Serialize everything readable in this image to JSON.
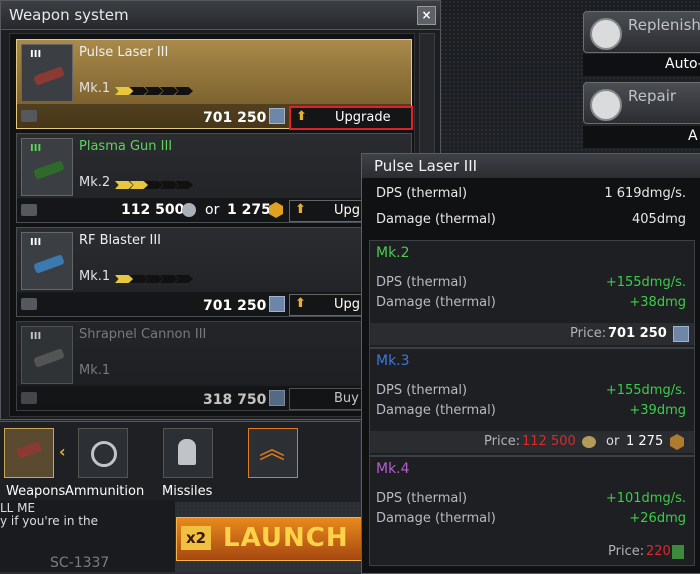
{
  "window": {
    "title": "Weapon system",
    "close_label": "×"
  },
  "weapons": [
    {
      "tier": "III",
      "name": "Pulse Laser III",
      "mk": "Mk.1",
      "level_fraction": 0.2,
      "price": "701 250",
      "button": "Upgrade",
      "selected": true
    },
    {
      "tier": "III",
      "name": "Plasma Gun III",
      "mk": "Mk.2",
      "level_fraction": 0.4,
      "price_red": "112 500",
      "or": "or",
      "price_alt": "1 275",
      "button": "Upgr",
      "selected": false
    },
    {
      "tier": "III",
      "name": "RF Blaster III",
      "mk": "Mk.1",
      "level_fraction": 0.2,
      "price": "701 250",
      "button": "Upgr",
      "selected": false
    },
    {
      "tier": "III",
      "name": "Shrapnel Cannon III",
      "mk": "Mk.1",
      "level_fraction": 0.0,
      "price": "318 750",
      "button": "Buy",
      "selected": false
    }
  ],
  "tabs": {
    "weapons": "Weapons",
    "ammunition": "Ammunition",
    "missiles": "Missiles"
  },
  "chat": {
    "line1": "LL ME",
    "line2": "y if you're in the"
  },
  "launch": {
    "multiplier": "x2",
    "label": "LAUNCH"
  },
  "callsign": "SC-1337",
  "side": {
    "replenish": "Replenish",
    "auto": "Auto-",
    "repair": "Repair",
    "a": "A"
  },
  "tooltip": {
    "title": "Pulse Laser III",
    "dps_label": "DPS (thermal)",
    "dps_value": "1 619dmg/s.",
    "dmg_label": "Damage (thermal)",
    "dmg_value": "405dmg",
    "levels": [
      {
        "name": "Mk.2",
        "color": "#4ec94e",
        "dps": "+155dmg/s.",
        "dmg": "+38dmg",
        "price_label": "Price:",
        "price": "701 250"
      },
      {
        "name": "Mk.3",
        "color": "#3f76d8",
        "dps": "+155dmg/s.",
        "dmg": "+39dmg",
        "price_label": "Price:",
        "price_red": "112 500",
        "or": "or",
        "price_alt": "1 275"
      },
      {
        "name": "Mk.4",
        "color": "#b45fd0",
        "dps": "+101dmg/s.",
        "dmg": "+26dmg",
        "price_label": "Price:",
        "price_red": "220"
      }
    ]
  }
}
